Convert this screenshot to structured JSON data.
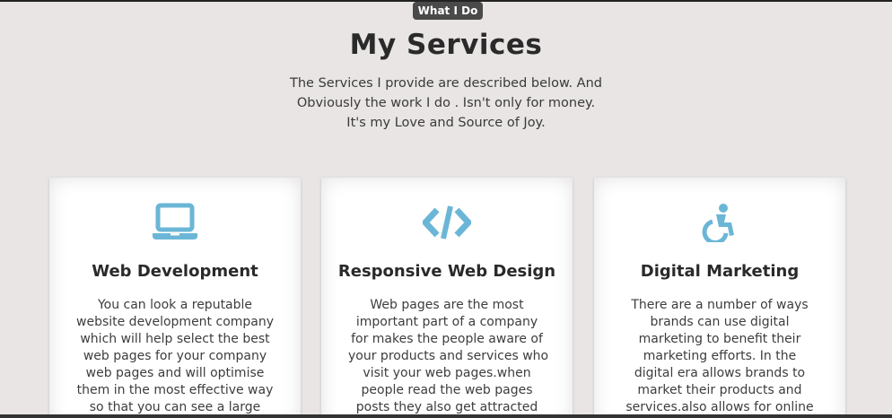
{
  "badge": {
    "label": "What I Do"
  },
  "header": {
    "title": "My Services",
    "subtitle_lines": [
      "The Services I provide are described below. And",
      "Obviously the work I do . Isn't only for money.",
      "It's my Love and Source of Joy."
    ]
  },
  "colors": {
    "accent": "#6bb6d6",
    "background": "#e8e5e4",
    "badge": "#4a4a4a"
  },
  "cards": [
    {
      "icon": "laptop-icon",
      "title": "Web Development",
      "lines": [
        "You can look a reputable",
        "website development company",
        "which will help select the best",
        "web pages for your company",
        "web pages and will optimise",
        "them in the most effective way",
        "so that you can see a large"
      ]
    },
    {
      "icon": "code-icon",
      "title": "Responsive Web Design",
      "lines": [
        "Web pages are the most",
        "important part of a company",
        "for makes the people aware of",
        "your products and services who",
        "visit your web pages.when",
        "people read the web pages",
        "posts they also get attracted"
      ]
    },
    {
      "icon": "accessibility-icon",
      "title": "Digital Marketing",
      "lines": [
        "There are a number of ways",
        "brands can use digital",
        "marketing to benefit their",
        "marketing efforts. In the",
        "digital era allows brands to",
        "market their products and",
        "services.also allows for online"
      ]
    }
  ]
}
